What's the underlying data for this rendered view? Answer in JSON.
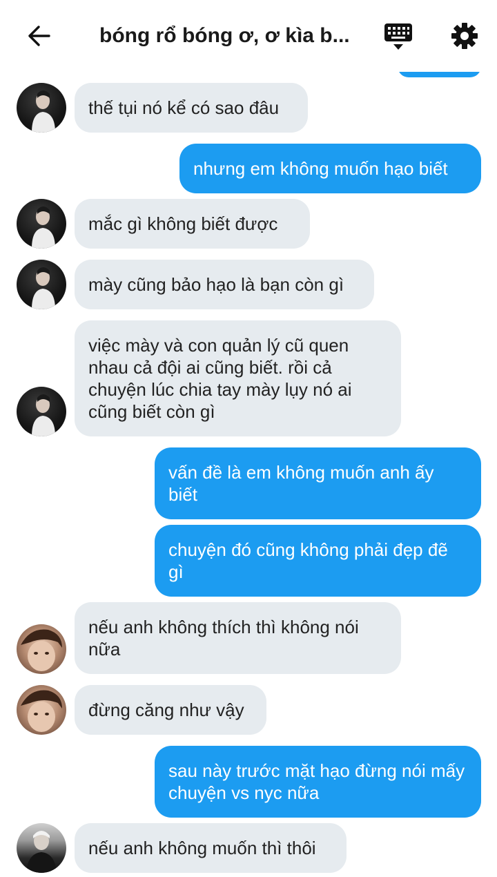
{
  "header": {
    "title": "bóng rổ bóng ơ, ơ kìa b...",
    "back_icon": "arrow-left-icon",
    "keyboard_icon": "keyboard-icon",
    "settings_icon": "gear-icon"
  },
  "colors": {
    "incoming_bubble": "#e6ebef",
    "outgoing_bubble": "#1c9cf1",
    "incoming_text": "#222222",
    "outgoing_text": "#ffffff"
  },
  "messages": [
    {
      "from": "them",
      "text": "thế tụi nó kể có sao đâu"
    },
    {
      "from": "me",
      "text": "nhưng em không muốn hạo biết"
    },
    {
      "from": "them",
      "text": "mắc gì không biết được"
    },
    {
      "from": "them",
      "text": "mày cũng bảo hạo là bạn còn gì"
    },
    {
      "from": "them",
      "text": "việc mày và con quản lý cũ quen nhau cả đội ai cũng biết. rồi cả chuyện lúc chia tay mày lụy nó ai cũng biết còn gì"
    },
    {
      "from": "me",
      "text": "vấn đề là em không muốn anh ấy biết"
    },
    {
      "from": "me",
      "text": "chuyện đó cũng không phải đẹp đẽ gì"
    },
    {
      "from": "them",
      "text": "nếu anh không thích thì không nói nữa"
    },
    {
      "from": "them",
      "text": "đừng căng như vậy"
    },
    {
      "from": "me",
      "text": "sau này trước mặt hạo đừng nói mấy chuyện vs nyc nữa"
    },
    {
      "from": "them",
      "text": "nếu anh không muốn thì thôi"
    }
  ]
}
